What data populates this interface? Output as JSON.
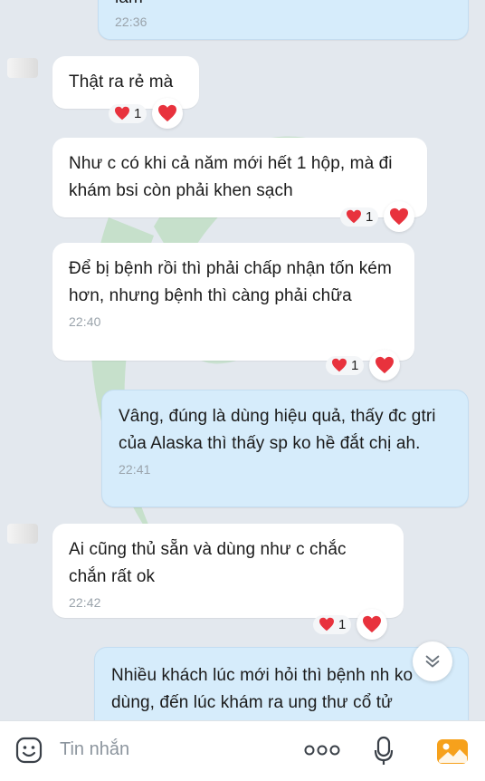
{
  "messages": [
    {
      "side": "out",
      "text": "lắm",
      "time": "22:36"
    },
    {
      "side": "in",
      "text": "Thật ra rẻ mà",
      "reaction_count": "1"
    },
    {
      "side": "in",
      "text": "Như c có khi cả năm mới hết 1 hộp, mà đi khám bsi còn phải khen sạch",
      "reaction_count": "1"
    },
    {
      "side": "in",
      "text": "Để bị bệnh rồi thì phải chấp nhận tốn kém hơn, nhưng bệnh thì càng phải chữa",
      "time": "22:40",
      "reaction_count": "1"
    },
    {
      "side": "out",
      "text": "Vâng, đúng là dùng hiệu quả, thấy đc gtri của Alaska thì thấy sp ko hề đắt chị ah.",
      "time": "22:41"
    },
    {
      "side": "in",
      "text": "Ai cũng thủ sẵn và dùng như c chắc chắn rất ok",
      "time": "22:42",
      "reaction_count": "1"
    },
    {
      "side": "out",
      "text": "Nhiều khách lúc mới hỏi thì bệnh nh ko dùng, đến lúc khám ra ung thư cổ tử cung thì ko dùng đc nữa. Mình cũng"
    }
  ],
  "input": {
    "placeholder": "Tin nhắn"
  },
  "colors": {
    "heart": "#e8323d",
    "bubble_out": "#d6ecfb",
    "bubble_in": "#ffffff",
    "background": "#e3e8ee"
  },
  "icons": [
    "emoji-icon",
    "more-icon",
    "microphone-icon",
    "image-icon",
    "chevron-down-icon",
    "heart-icon"
  ]
}
